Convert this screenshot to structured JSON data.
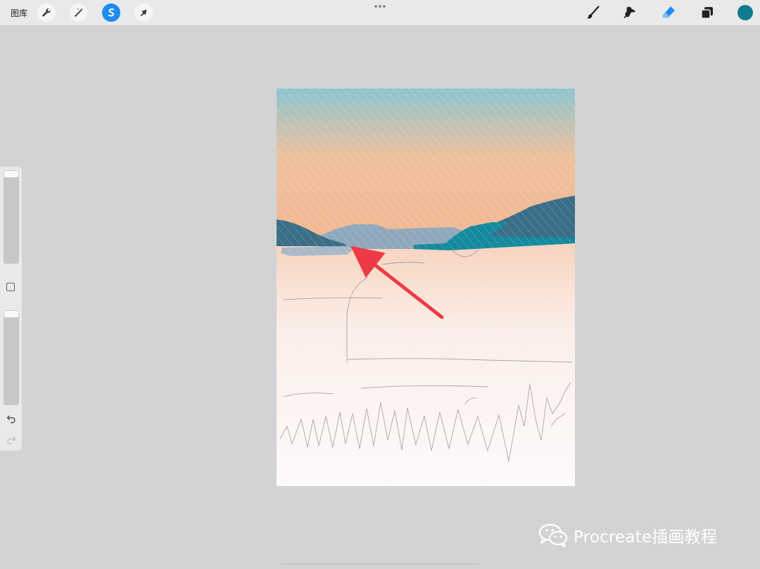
{
  "toolbar": {
    "gallery_label": "图库",
    "left_tools": [
      "wrench-icon",
      "magic-wand-icon",
      "selection-icon",
      "transform-arrow-icon"
    ],
    "right_tools": [
      "brush-icon",
      "smudge-icon",
      "eraser-icon",
      "layers-icon",
      "color-icon"
    ],
    "active_color": "#0f7b8f",
    "accent_color": "#1e8cf0"
  },
  "sidebar": {
    "brush_size_level": 0.0,
    "opacity_level": 0.0
  },
  "canvas": {
    "sky_top_color": "#8ec5cf",
    "sky_bottom_color": "#f1b894",
    "mountain_color": "#3a6d86",
    "water_color": "#148a9e",
    "annotation_color": "#ee3a46"
  },
  "watermark": {
    "text": "Procreate插画教程"
  }
}
